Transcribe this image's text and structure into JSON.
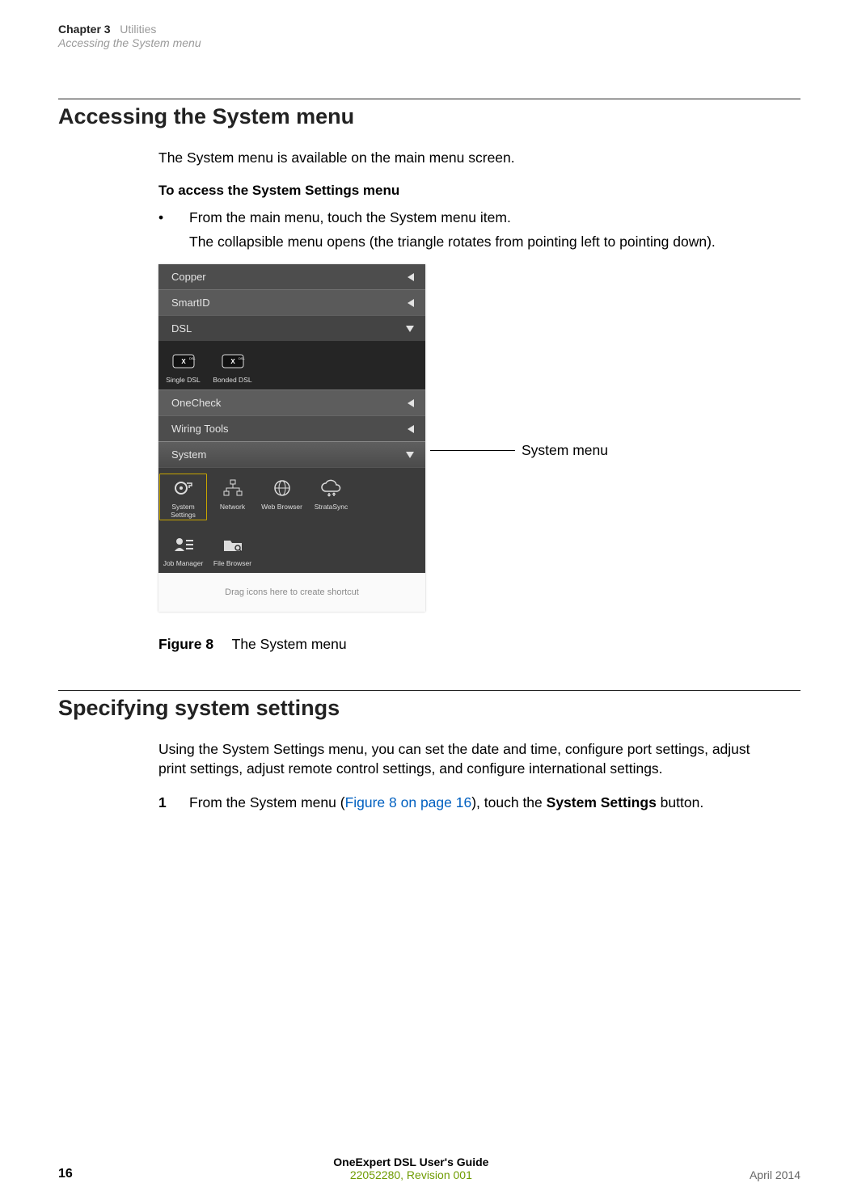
{
  "header": {
    "chapter_label": "Chapter 3",
    "chapter_name": "Utilities",
    "section_sub": "Accessing the System menu"
  },
  "section1": {
    "title": "Accessing the System menu",
    "intro": "The System menu is available on the main menu screen.",
    "subhead": "To access the System Settings menu",
    "bullet_text": "From the main menu, touch the System menu item.",
    "bullet_sub": "The collapsible menu opens (the triangle rotates from pointing left to pointing down)."
  },
  "screenshot": {
    "menus": {
      "copper": "Copper",
      "smartid": "SmartID",
      "dsl": "DSL",
      "onecheck": "OneCheck",
      "wiring": "Wiring Tools",
      "system": "System"
    },
    "dsl_icons": {
      "single": "Single DSL",
      "bonded": "Bonded DSL"
    },
    "system_icons": {
      "settings": "System\nSettings",
      "network": "Network",
      "browser": "Web Browser",
      "stratasync": "StrataSync",
      "jobmanager": "Job Manager",
      "filebrowser": "File Browser"
    },
    "drag_hint": "Drag icons here to create shortcut"
  },
  "callout": {
    "label": "System menu"
  },
  "figure": {
    "num": "Figure 8",
    "caption": "The System menu"
  },
  "section2": {
    "title": "Specifying system settings",
    "intro": "Using the System Settings menu, you can set the date and time, configure port settings, adjust print settings, adjust remote control settings, and configure international settings.",
    "step1_pre": "From the System menu (",
    "step1_xref": "Figure 8 on page 16",
    "step1_mid": "), touch the ",
    "step1_bold": "System Settings",
    "step1_post": " button."
  },
  "footer": {
    "page": "16",
    "guide_title": "OneExpert DSL User's Guide",
    "doc_id": "22052280, Revision 001",
    "date": "April 2014"
  }
}
